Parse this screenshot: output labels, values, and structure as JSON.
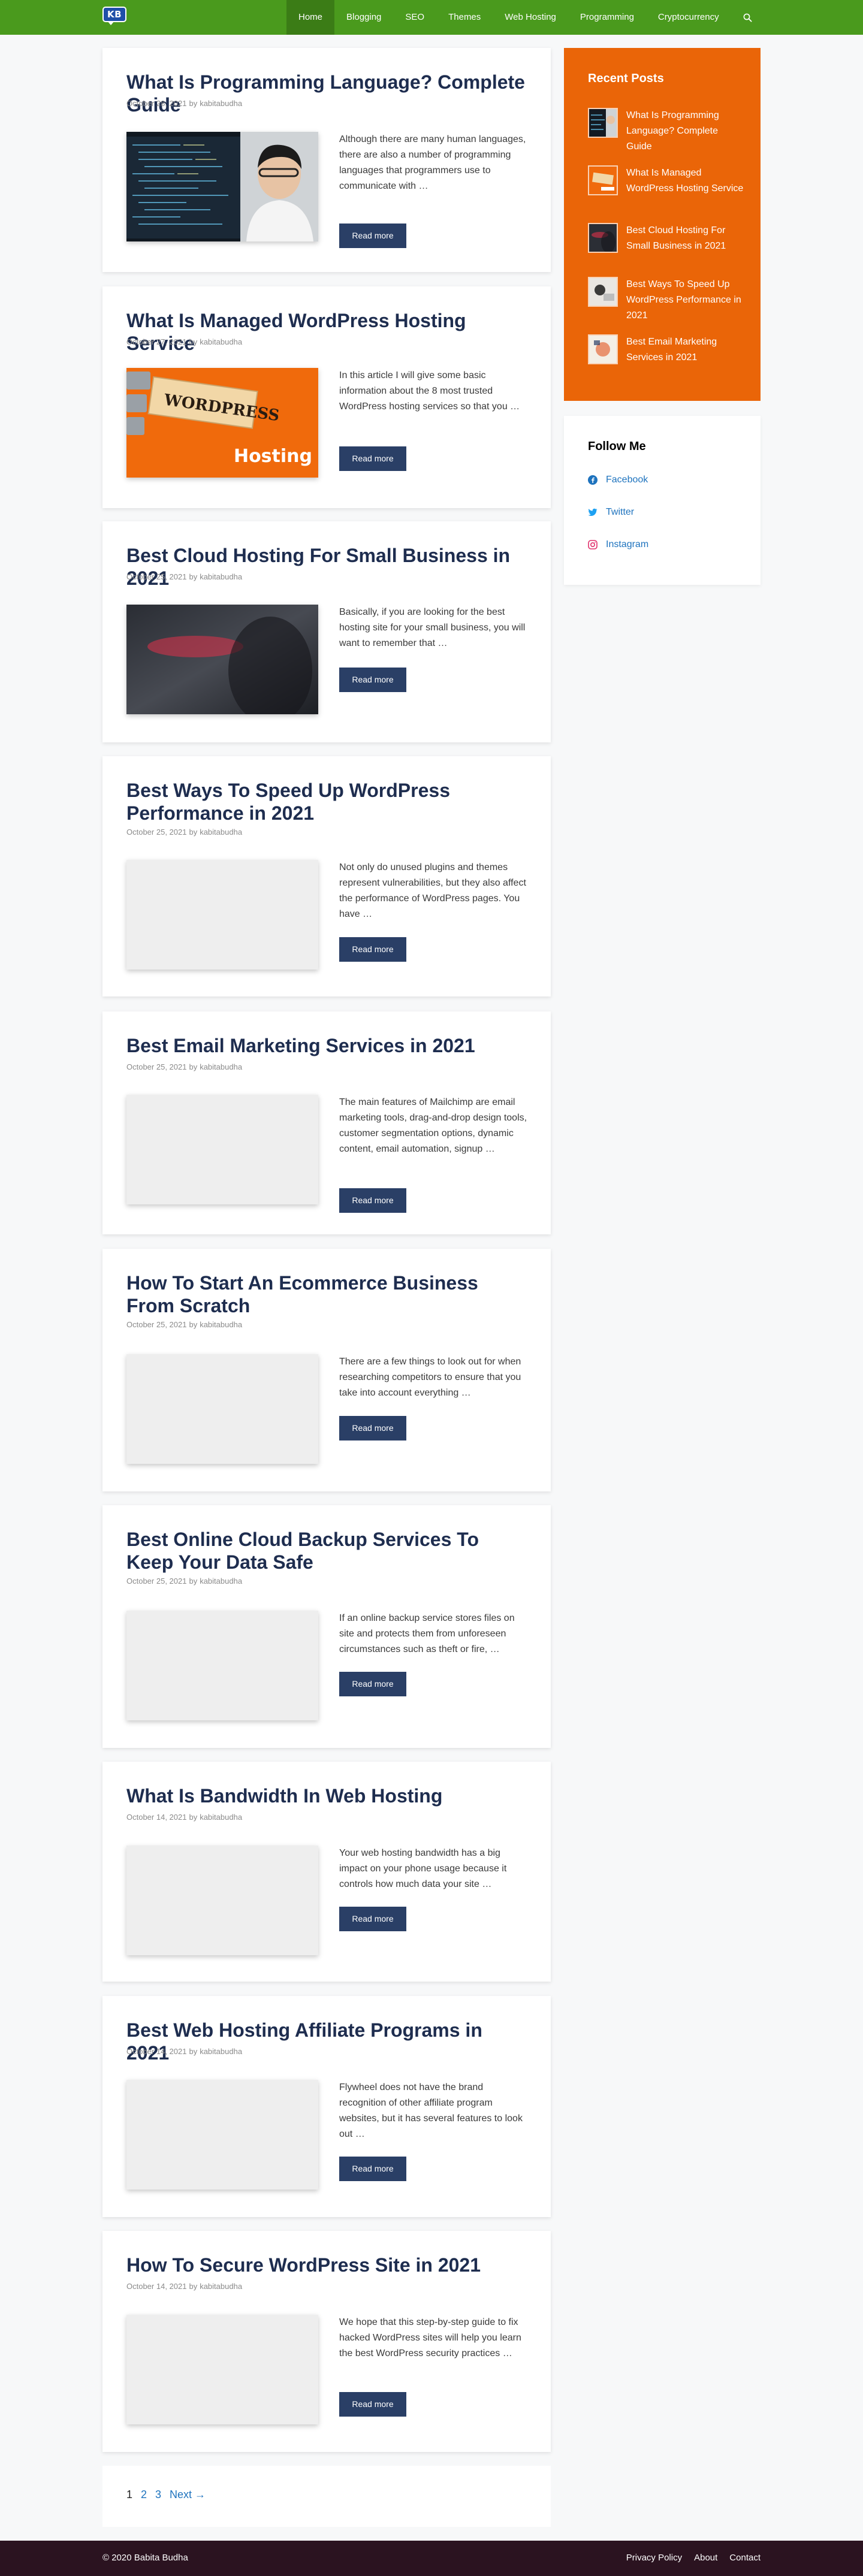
{
  "site": {
    "logo_text": "KB"
  },
  "nav": {
    "items": [
      "Home",
      "Blogging",
      "SEO",
      "Themes",
      "Web Hosting",
      "Programming",
      "Cryptocurrency"
    ],
    "active": "Home",
    "search_icon": "search-icon"
  },
  "posts": [
    {
      "title": "What Is Programming Language? Complete Guide",
      "date": "October 28, 2021",
      "author": "kabitabudha",
      "excerpt": "Although there are many human languages, there are also a number of programming languages that programmers use to communicate with …",
      "read_more": "Read more",
      "image": "programmer-at-monitor-photo"
    },
    {
      "title": "What Is Managed WordPress Hosting Service",
      "date": "October 27, 2021",
      "author": "kabitabudha",
      "excerpt": "In this article I will give some basic information about the 8 most trusted WordPress hosting services so that you …",
      "read_more": "Read more",
      "image": "wordpress-hosting-graphic",
      "image_text": [
        "WORDPRESS",
        "Hosting"
      ]
    },
    {
      "title": "Best Cloud Hosting For Small Business in 2021",
      "date": "October 25, 2021",
      "author": "kabitabudha",
      "excerpt": "Basically, if you are looking for the best hosting site for your small business, you will want to remember that …",
      "read_more": "Read more",
      "image": "cloud-hosting-photo"
    },
    {
      "title": "Best Ways To Speed Up WordPress Performance in 2021",
      "date": "October 25, 2021",
      "author": "kabitabudha",
      "excerpt": "Not only do unused plugins and themes represent vulnerabilities, but they also affect the performance of WordPress pages. You have …",
      "read_more": "Read more",
      "image": "placeholder"
    },
    {
      "title": "Best Email Marketing Services in 2021",
      "date": "October 25, 2021",
      "author": "kabitabudha",
      "excerpt": "The main features of Mailchimp are email marketing tools, drag-and-drop design tools, customer segmentation options, dynamic content, email automation, signup …",
      "read_more": "Read more",
      "image": "placeholder"
    },
    {
      "title": "How To Start An Ecommerce Business From Scratch",
      "date": "October 25, 2021",
      "author": "kabitabudha",
      "excerpt": "There are a few things to look out for when researching competitors to ensure that you take into account everything …",
      "read_more": "Read more",
      "image": "placeholder"
    },
    {
      "title": "Best Online Cloud Backup Services To Keep Your Data Safe",
      "date": "October 25, 2021",
      "author": "kabitabudha",
      "excerpt": "If an online backup service stores files on site and protects them from unforeseen circumstances such as theft or fire, …",
      "read_more": "Read more",
      "image": "placeholder"
    },
    {
      "title": "What Is Bandwidth In Web Hosting",
      "date": "October 14, 2021",
      "author": "kabitabudha",
      "excerpt": "Your web hosting bandwidth has a big impact on your phone usage because it controls how much data your site …",
      "read_more": "Read more",
      "image": "placeholder"
    },
    {
      "title": "Best Web Hosting Affiliate Programs in 2021",
      "date": "October 14, 2021",
      "author": "kabitabudha",
      "excerpt": "Flywheel does not have the brand recognition of other affiliate program websites, but it has several features to look out …",
      "read_more": "Read more",
      "image": "placeholder"
    },
    {
      "title": "How To Secure WordPress Site in 2021",
      "date": "October 14, 2021",
      "author": "kabitabudha",
      "excerpt": "We hope that this step-by-step guide to fix hacked WordPress sites will help you learn the best WordPress security practices …",
      "read_more": "Read more",
      "image": "placeholder"
    }
  ],
  "meta_by": "by",
  "sidebar": {
    "recent_title": "Recent Posts",
    "recent": [
      "What Is Programming Language? Complete Guide",
      "What Is Managed WordPress Hosting Service",
      "Best Cloud Hosting For Small Business in 2021",
      "Best Ways To Speed Up WordPress Performance in 2021",
      "Best Email Marketing Services in 2021"
    ],
    "follow_title": "Follow Me",
    "follow": [
      {
        "label": "Facebook",
        "icon": "facebook-icon"
      },
      {
        "label": "Twitter",
        "icon": "twitter-icon"
      },
      {
        "label": "Instagram",
        "icon": "instagram-icon"
      }
    ]
  },
  "pagination": {
    "pages": [
      "1",
      "2",
      "3"
    ],
    "current": "1",
    "next": "Next →"
  },
  "footer": {
    "copyright": "© 2020 Babita Budha",
    "links": [
      "Privacy Policy",
      "About",
      "Contact"
    ]
  },
  "colors": {
    "header_green": "#4a9a1d",
    "recent_orange": "#ea6508",
    "title_navy": "#1e2d4f",
    "button_navy": "#2a3f66",
    "footer": "#2b1320",
    "link_blue": "#1e73be"
  }
}
